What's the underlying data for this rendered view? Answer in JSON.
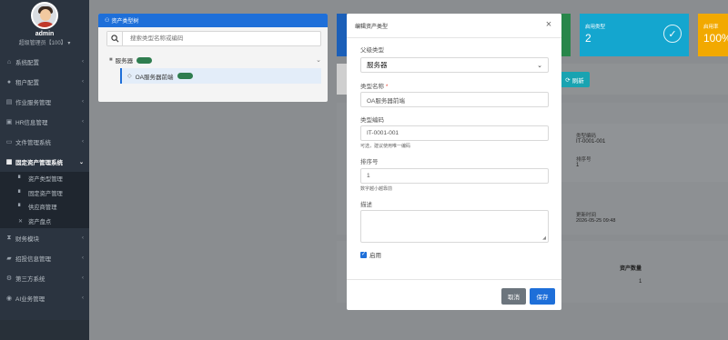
{
  "sidebar": {
    "user": {
      "name": "admin",
      "role": "超级管理员【100】"
    },
    "role_chevron": "▾",
    "items": [
      {
        "label": "系统配置",
        "icon": "bank-icon",
        "glyph": "⌂"
      },
      {
        "label": "租户配置",
        "icon": "user-icon",
        "glyph": "●"
      },
      {
        "label": "作业服务管理",
        "icon": "server-icon",
        "glyph": "▤"
      },
      {
        "label": "HR信息管理",
        "icon": "id-card-icon",
        "glyph": "▣"
      },
      {
        "label": "文件管理系统",
        "icon": "file-icon",
        "glyph": "▭"
      },
      {
        "label": "固定资产管理系统",
        "icon": "briefcase-icon",
        "glyph": "▦"
      },
      {
        "label": "财务模块",
        "icon": "hourglass-icon",
        "glyph": "⧗"
      },
      {
        "label": "招投信息管理",
        "icon": "folder-icon",
        "glyph": "▰"
      },
      {
        "label": "第三方系统",
        "icon": "gear-icon",
        "glyph": "⚙"
      },
      {
        "label": "AI业务管理",
        "icon": "robot-icon",
        "glyph": "◉"
      }
    ],
    "sub_items": [
      {
        "label": "资产类型管理",
        "icon": "document-icon",
        "glyph": "▘"
      },
      {
        "label": "固定资产管理",
        "icon": "document-icon",
        "glyph": "▘"
      },
      {
        "label": "供应商管理",
        "icon": "document-icon",
        "glyph": "▘"
      },
      {
        "label": "资产盘点",
        "icon": "cross-icon",
        "glyph": "✕"
      }
    ]
  },
  "tree_panel": {
    "title": "资产类型树",
    "search_placeholder": "搜索类型名称或编码",
    "root_node": "服务器",
    "child_node": "OA服务器前端"
  },
  "background": {
    "stats": [
      {
        "label": "启用类型",
        "value": "2",
        "color": "#14a6cf"
      },
      {
        "label": "启用率",
        "value": "100%",
        "color": "#f2a900"
      }
    ],
    "refresh_label": "刷新",
    "detail": {
      "code_label": "类型编码",
      "code_value": "IT-0001-001",
      "sort_label": "排序号",
      "sort_value": "1",
      "updated_label": "更新时间",
      "updated_value": "2026-05-25 09:48",
      "count_header": "资产数量",
      "count_value": "1"
    }
  },
  "modal": {
    "title": "编辑资产类型",
    "close": "×",
    "parent_label": "父级类型",
    "parent_value": "服务器",
    "name_label": "类型名称",
    "name_required": "*",
    "name_value": "OA服务器前端",
    "code_label": "类型编码",
    "code_value": "IT-0001-001",
    "code_help": "可选，建议使用唯一编码",
    "sort_label": "排序号",
    "sort_value": "1",
    "sort_help": "数字越小越靠前",
    "desc_label": "描述",
    "enabled_label": "启用",
    "enabled_checked": "✓",
    "cancel_label": "取消",
    "save_label": "保存"
  },
  "colors": {
    "primary": "#1e6fd9",
    "sidebar": "#2b3440",
    "badge": "#2f7d4f",
    "refresh": "#19a3b1",
    "cancel": "#6c757d"
  }
}
